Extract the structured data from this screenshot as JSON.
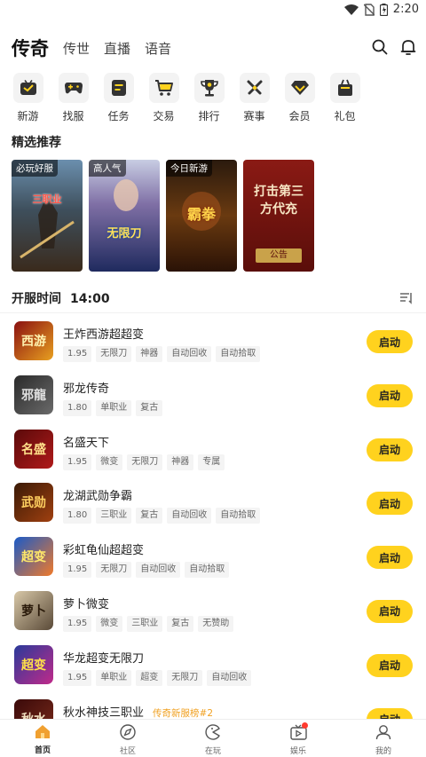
{
  "status_bar": {
    "time": "2:20"
  },
  "top_nav": {
    "active_tab": "传奇",
    "tabs": [
      "传世",
      "直播",
      "语音"
    ]
  },
  "shortcuts": [
    {
      "label": "新游",
      "icon": "new-game-icon"
    },
    {
      "label": "找服",
      "icon": "gamepad-icon"
    },
    {
      "label": "任务",
      "icon": "task-icon"
    },
    {
      "label": "交易",
      "icon": "cart-icon"
    },
    {
      "label": "排行",
      "icon": "trophy-icon"
    },
    {
      "label": "赛事",
      "icon": "crossed-swords-icon"
    },
    {
      "label": "会员",
      "icon": "diamond-icon"
    },
    {
      "label": "礼包",
      "icon": "gift-icon"
    }
  ],
  "featured": {
    "title": "精选推荐",
    "cards": [
      {
        "tag": "必玩好服",
        "art_text": "三职业"
      },
      {
        "tag": "高人气",
        "art_text": "无限刀"
      },
      {
        "tag": "今日新游",
        "art_text": "霸拳"
      },
      {
        "tag": "",
        "art_text": "打击第三方代充",
        "badge": "公告"
      }
    ]
  },
  "server_list": {
    "title": "开服时间",
    "time": "14:00",
    "action_label": "启动",
    "games": [
      {
        "name": "王炸西游超超变",
        "rank": "",
        "icon_text": "西游",
        "tags": [
          "1.95",
          "无限刀",
          "神器",
          "自动回收",
          "自动拾取"
        ]
      },
      {
        "name": "邪龙传奇",
        "rank": "",
        "icon_text": "邪龍",
        "tags": [
          "1.80",
          "单职业",
          "复古"
        ]
      },
      {
        "name": "名盛天下",
        "rank": "",
        "icon_text": "名盛",
        "tags": [
          "1.95",
          "微变",
          "无限刀",
          "神器",
          "专属"
        ]
      },
      {
        "name": "龙湖武勋争霸",
        "rank": "",
        "icon_text": "武勋",
        "tags": [
          "1.80",
          "三职业",
          "复古",
          "自动回收",
          "自动拾取"
        ]
      },
      {
        "name": "彩虹龟仙超超变",
        "rank": "",
        "icon_text": "超变",
        "tags": [
          "1.95",
          "无限刀",
          "自动回收",
          "自动拾取"
        ]
      },
      {
        "name": "萝卜微变",
        "rank": "",
        "icon_text": "萝卜",
        "tags": [
          "1.95",
          "微变",
          "三职业",
          "复古",
          "无赞助"
        ]
      },
      {
        "name": "华龙超变无限刀",
        "rank": "",
        "icon_text": "超变",
        "tags": [
          "1.95",
          "单职业",
          "超变",
          "无限刀",
          "自动回收"
        ]
      },
      {
        "name": "秋水神技三职业",
        "rank": "传奇新服榜#2",
        "icon_text": "秋水",
        "tags": []
      }
    ]
  },
  "bottom_nav": [
    {
      "label": "首页",
      "active": true
    },
    {
      "label": "社区",
      "active": false
    },
    {
      "label": "在玩",
      "active": false
    },
    {
      "label": "娱乐",
      "active": false,
      "dot": true
    },
    {
      "label": "我的",
      "active": false
    }
  ],
  "colors": {
    "accent": "#ffd21e",
    "rank": "#f0a020",
    "notification": "#ff3b30"
  }
}
